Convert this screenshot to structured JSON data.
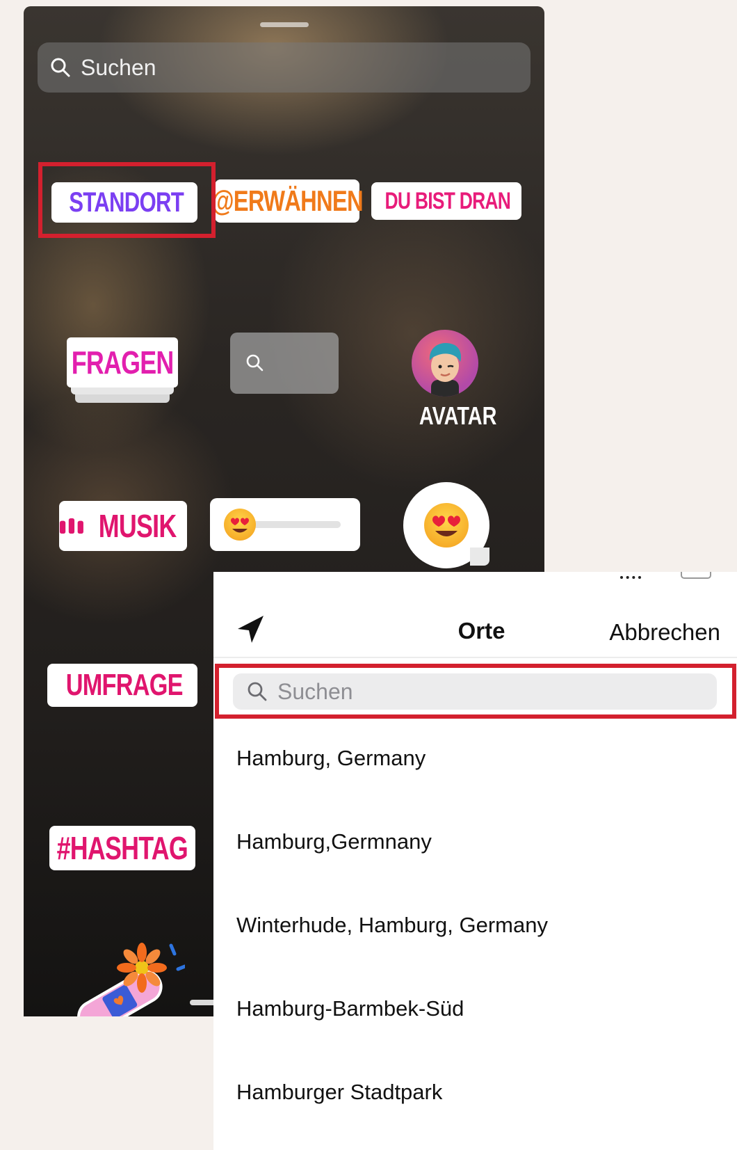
{
  "sticker_panel": {
    "search_placeholder": "Suchen",
    "stickers": {
      "standort": "STANDORT",
      "erwaehnen": "@ERWÄHNEN",
      "du_bist_dran": "DU BIST DRAN",
      "fragen": "FRAGEN",
      "avatar": "AVATAR",
      "musik": "MUSIK",
      "umfrage": "UMFRAGE",
      "hashtag": "#HASHTAG"
    },
    "colors": {
      "standort": "#7b3ff2",
      "erwaehnen": "#f07a1a",
      "du_bist_dran": "#e81c7a",
      "fragen": "#e21fae",
      "musik": "#e0156e",
      "umfrage": "#e0156e",
      "hashtag": "#e0156e",
      "highlight": "#d3202e"
    }
  },
  "places_panel": {
    "title": "Orte",
    "cancel_label": "Abbrechen",
    "search_placeholder": "Suchen",
    "items": [
      "Hamburg, Germany",
      "Hamburg,Germnany",
      "Winterhude, Hamburg, Germany",
      "Hamburg-Barmbek-Süd",
      "Hamburger Stadtpark"
    ]
  }
}
